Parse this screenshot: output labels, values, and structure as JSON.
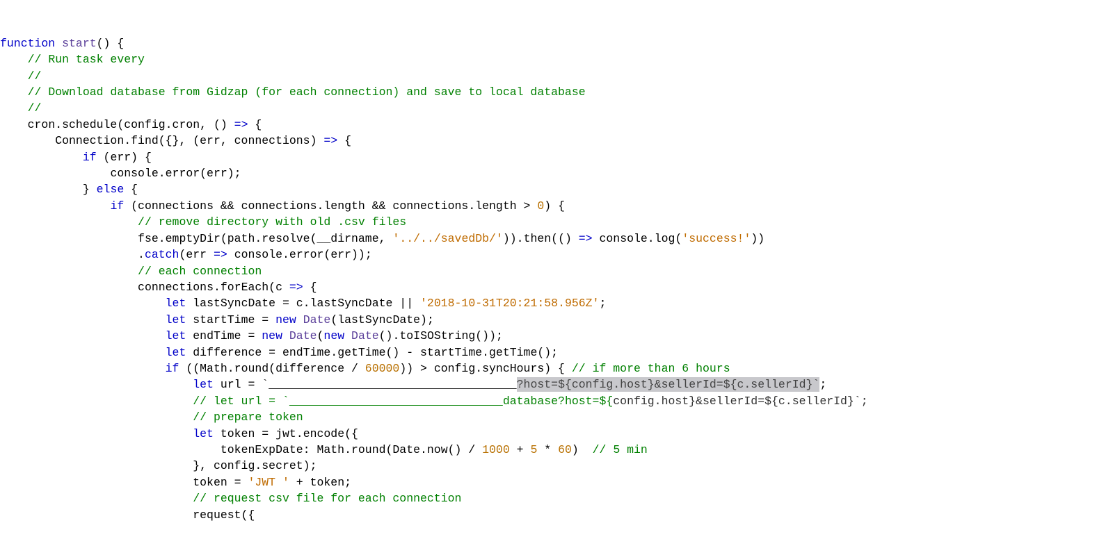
{
  "code": {
    "kw_function": "function",
    "fn_start": "start",
    "cm_runTask": "// Run task every",
    "cm_blank1": "//",
    "cm_download": "// Download database from Gidzap (for each connection) and save to local database",
    "cm_blank2": "//",
    "id_cron": "cron.schedule(config.cron, () ",
    "arrow": "=>",
    "id_connFind": "Connection.find({}, (err, connections) ",
    "kw_if": "if",
    "id_err": " (err) {",
    "id_consoleErr": "console.error(err);",
    "kw_else": "else",
    "id_connChk": " (connections && connections.length && connections.length > ",
    "num_0": "0",
    "cm_removeDir": "// remove directory with old .csv files",
    "id_fseEmpty1": "fse.emptyDir(path.resolve(__dirname, ",
    "str_savedDb": "'../../savedDb/'",
    "id_fseEmpty2": ")).then(() ",
    "id_consoleLog": " console.log(",
    "str_success": "'success!'",
    "id_catch": ".",
    "kw_catch": "catch",
    "id_catch2": "(err ",
    "id_catch3": " console.error(err));",
    "cm_eachConn": "// each connection",
    "id_forEach": "connections.forEach(c ",
    "kw_let": "let",
    "id_lastSync": " lastSyncDate = c.lastSyncDate || ",
    "str_date": "'2018-10-31T20:21:58.956Z'",
    "id_startTime": " startTime = ",
    "kw_new": "new",
    "fn_Date": "Date",
    "id_startTime2": "(lastSyncDate);",
    "id_endTime": " endTime = ",
    "id_endTime2": "(",
    "id_endTime3": "().toISOString());",
    "id_diff": " difference = endTime.getTime() - startTime.getTime();",
    "id_mathRound": " ((Math.round(difference / ",
    "num_60000": "60000",
    "id_mathRound2": ")) > config.syncHours) { ",
    "cm_6hours": "// if more than 6 hours",
    "id_url": " url = ",
    "sel_url1": "?host=${config.host}&sellerId=${c.sellerId}`",
    "cm_letUrl": "// let url = `",
    "cm_urlTail": "database?host=${",
    "tpl_rest": "config.host}&sellerId=${c.sellerId}`;",
    "cm_prepToken": "// prepare token",
    "id_token": " token = jwt.encode({",
    "id_tokenExp": "tokenExpDate: Math.round(Date.now() / ",
    "num_1000": "1000",
    "id_plus": " + ",
    "num_5": "5",
    "id_times": " * ",
    "num_60": "60",
    "id_tokenExp2": ")  ",
    "cm_5min": "// 5 min",
    "id_secret": "}, config.secret);",
    "id_token2": "token = ",
    "str_jwt": "'JWT '",
    "id_token3": " + token;",
    "cm_request": "// request csv file for each connection",
    "id_request": "request({"
  }
}
